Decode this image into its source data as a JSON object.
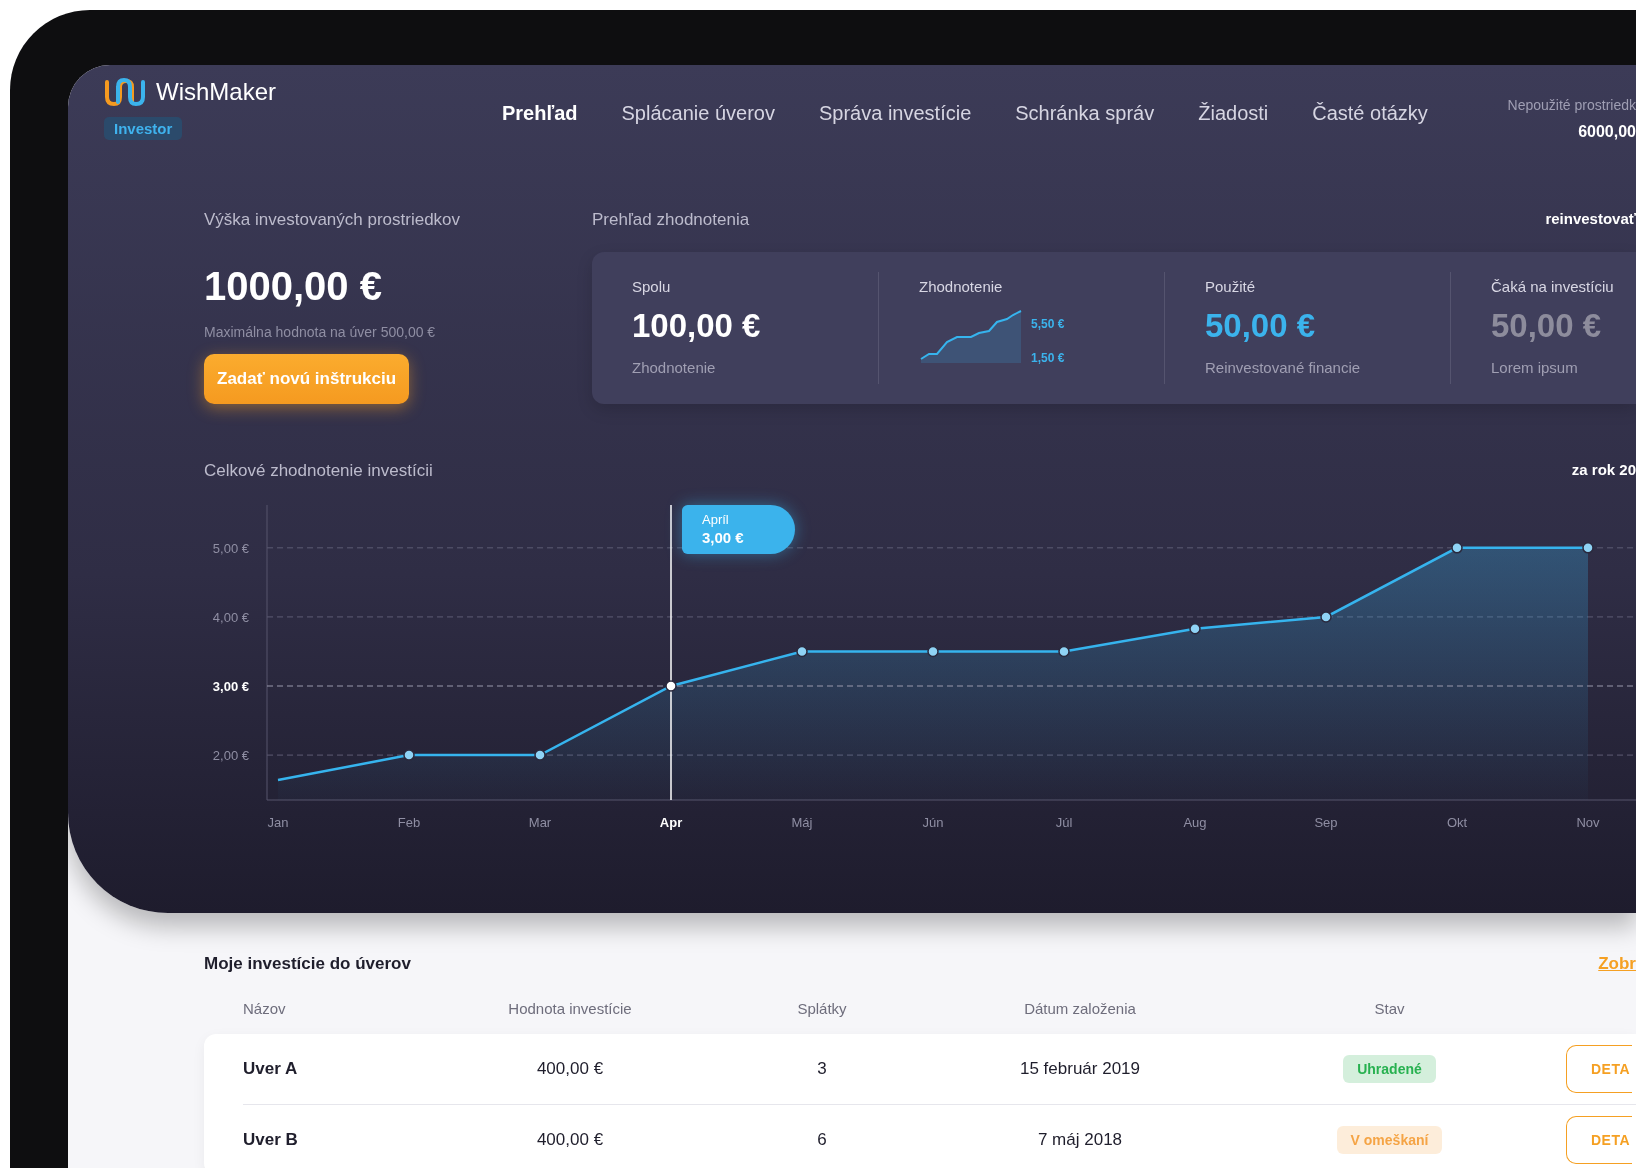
{
  "header": {
    "brand": "WishMaker",
    "role_badge": "Investor",
    "nav": [
      {
        "label": "Prehľad",
        "selected": true
      },
      {
        "label": "Splácanie úverov",
        "selected": false
      },
      {
        "label": "Správa investície",
        "selected": false
      },
      {
        "label": "Schránka správ",
        "selected": false
      },
      {
        "label": "Žiadosti",
        "selected": false
      },
      {
        "label": "Časté otázky",
        "selected": false
      }
    ],
    "balance": {
      "label": "Nepoužité prostriedk",
      "value": "6000,00"
    }
  },
  "invested": {
    "title": "Výška investovaných prostriedkov",
    "amount": "1000,00 €",
    "note": "Maximálna hodnota na úver 500,00 €",
    "button": "Zadať novú inštrukciu"
  },
  "overview": {
    "title": "Prehľad zhodnotenia",
    "link": "reinvestovať",
    "stats": [
      {
        "kind": "value",
        "label": "Spolu",
        "value": "100,00 €",
        "caption": "Zhodnotenie",
        "color": "#ffffff"
      },
      {
        "kind": "sparkline",
        "label": "Zhodnotenie",
        "high": "5,50 €",
        "low": "1,50 €"
      },
      {
        "kind": "value",
        "label": "Použité",
        "value": "50,00 €",
        "caption": "Reinvestované financie",
        "color": "#3bb3ec"
      },
      {
        "kind": "value",
        "label": "Čaká na investíciu",
        "value": "50,00 €",
        "caption": "Lorem ipsum",
        "color": "#8d8c9c"
      }
    ]
  },
  "performance": {
    "title": "Celkové zhodnotenie investícii",
    "period": "za rok 20",
    "chart_data": {
      "type": "area",
      "categories": [
        "Jan",
        "Feb",
        "Mar",
        "Apr",
        "Máj",
        "Jún",
        "Júl",
        "Aug",
        "Sep",
        "Okt",
        "Nov"
      ],
      "series": [
        {
          "color": "#36b4ee",
          "values": [
            1.64,
            2,
            2,
            3,
            3.5,
            3.5,
            3.5,
            3.83,
            4,
            5,
            5
          ]
        }
      ],
      "grid": true,
      "ylim": [
        1.35,
        5.62
      ],
      "yticks": [
        {
          "value": 2,
          "label": "2,00 €"
        },
        {
          "value": 3,
          "label": "3,00 €"
        },
        {
          "value": 4,
          "label": "4,00 €"
        },
        {
          "value": 5,
          "label": "5,00 €"
        }
      ],
      "ref_lines": [
        {
          "axis": "x",
          "value": "Apr",
          "color": "#ffffff"
        },
        {
          "axis": "y",
          "value": 3,
          "color": "#9a99ad"
        }
      ]
    },
    "tooltip": {
      "title": "Apríl",
      "value": "3,00 €"
    }
  },
  "loans": {
    "title": "Moje investície do úverov",
    "link": "Zobr",
    "columns": [
      "Názov",
      "Hodnota investície",
      "Splátky",
      "Dátum založenia",
      "Stav"
    ],
    "rows": [
      {
        "name": "Uver A",
        "value": "400,00 €",
        "installments": "3",
        "date": "15 február 2019",
        "status": {
          "label": "Uhradené",
          "color": "#27b150"
        },
        "action": "DETA"
      },
      {
        "name": "Uver B",
        "value": "400,00 €",
        "installments": "6",
        "date": "7 máj 2018",
        "status": {
          "label": "V omeškaní",
          "color": "#f5a445"
        },
        "action": "DETA"
      }
    ]
  }
}
